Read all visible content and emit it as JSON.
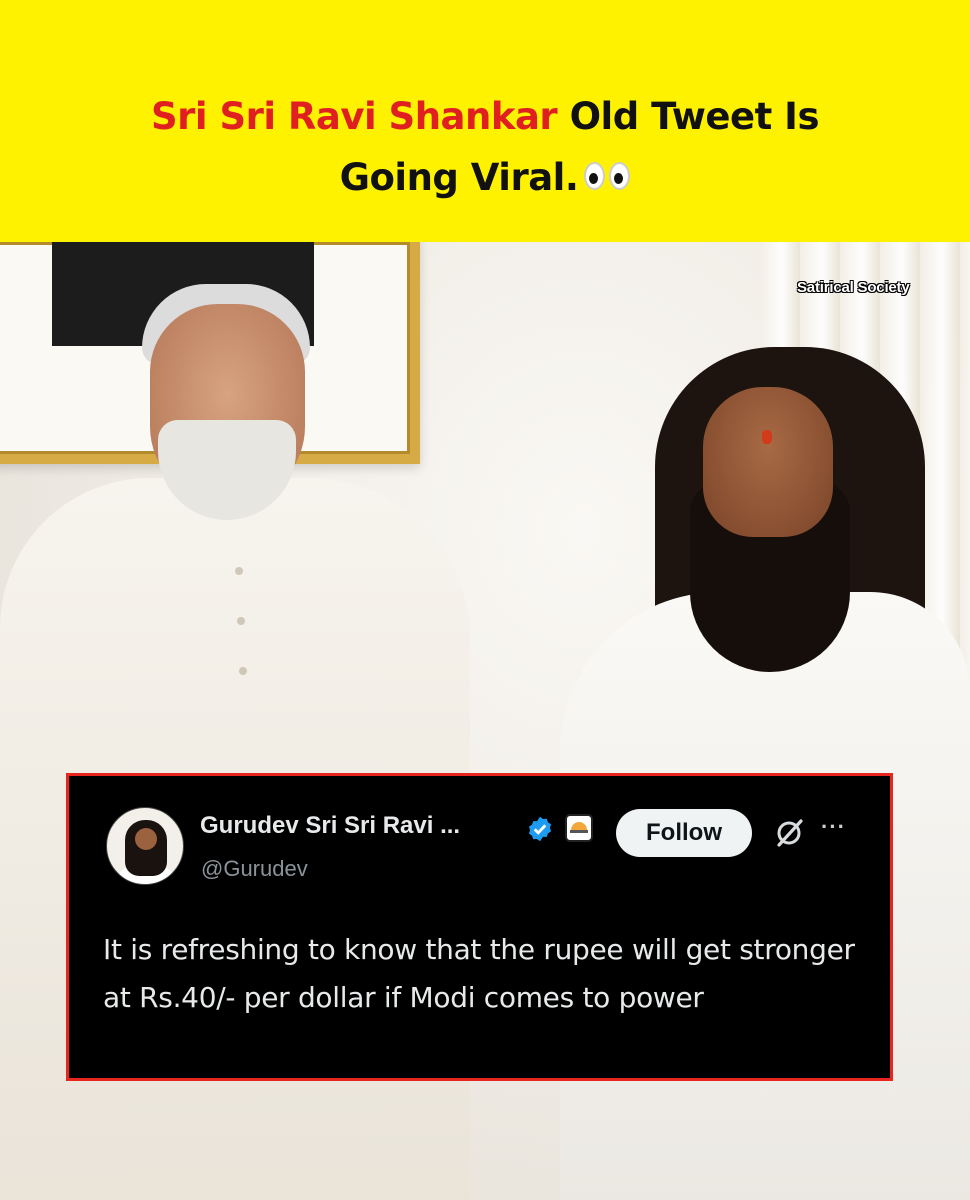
{
  "headline": {
    "highlight": "Sri Sri Ravi Shankar",
    "rest_line1": " Old Tweet Is",
    "line2": "Going Viral.",
    "emoji_icon": "eyes-emoji-icon",
    "highlight_color": "#e02020",
    "background_color": "#fef200"
  },
  "watermark": "Satirical Society",
  "tweet": {
    "display_name": "Gurudev Sri Sri Ravi ...",
    "handle": "@Gurudev",
    "verified_icon": "verified-badge-icon",
    "affiliation_icon": "organization-badge-icon",
    "follow_label": "Follow",
    "grok_icon": "grok-icon",
    "more_icon": "more-options-icon",
    "more_glyph": "···",
    "text": "It is refreshing to know that the rupee will get stronger at Rs.40/- per dollar if Modi comes to power",
    "border_color": "#e8261f"
  }
}
